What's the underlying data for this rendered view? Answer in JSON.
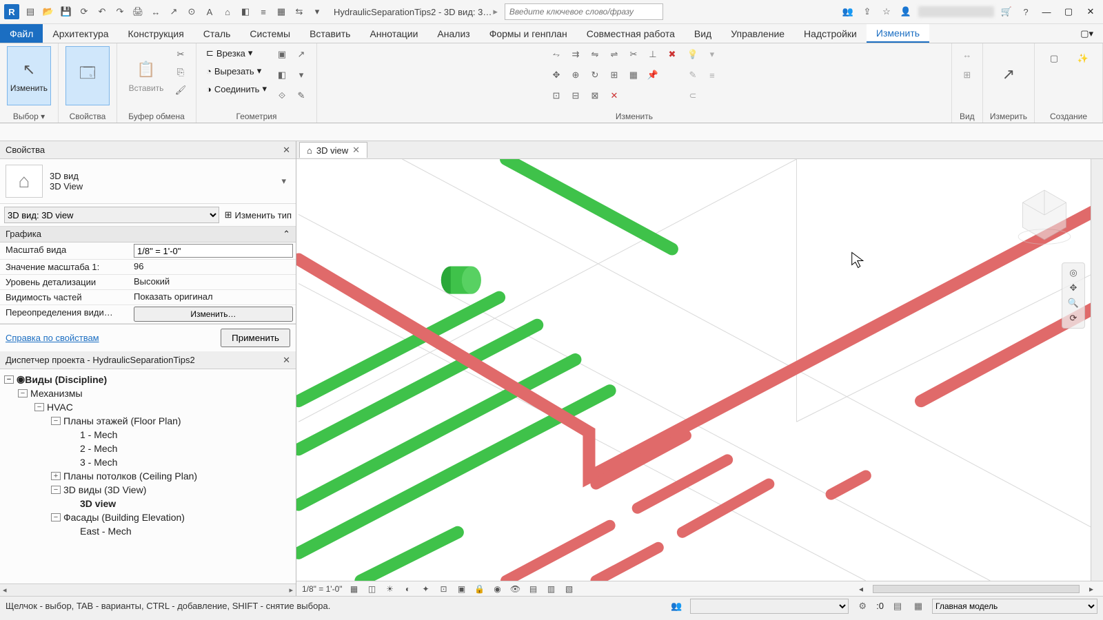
{
  "titlebar": {
    "doc_title": "HydraulicSeparationTips2 - 3D вид: 3…",
    "search_placeholder": "Введите ключевое слово/фразу"
  },
  "ribbon_tabs": [
    "Файл",
    "Архитектура",
    "Конструкция",
    "Сталь",
    "Системы",
    "Вставить",
    "Аннотации",
    "Анализ",
    "Формы и генплан",
    "Совместная работа",
    "Вид",
    "Управление",
    "Надстройки",
    "Изменить"
  ],
  "ribbon_active_index": 13,
  "ribbon": {
    "select": {
      "modify": "Изменить",
      "label": "Выбор"
    },
    "properties": {
      "label": "Свойства"
    },
    "clipboard": {
      "paste": "Вставить",
      "label": "Буфер обмена"
    },
    "geometry": {
      "cope": "Врезка",
      "cut": "Вырезать",
      "join": "Соединить",
      "label": "Геометрия"
    },
    "modify": {
      "label": "Изменить"
    },
    "view": {
      "label": "Вид"
    },
    "measure": {
      "label": "Измерить"
    },
    "create": {
      "label": "Создание"
    }
  },
  "properties": {
    "title": "Свойства",
    "family": "3D вид",
    "type": "3D View",
    "instance_selector": "3D вид: 3D view",
    "edit_type": "Изменить тип",
    "group": "Графика",
    "rows": [
      {
        "k": "Масштаб вида",
        "v": "1/8\" = 1'-0\"",
        "kind": "input"
      },
      {
        "k": "Значение масштаба    1:",
        "v": "96",
        "kind": "text"
      },
      {
        "k": "Уровень детализации",
        "v": "Высокий",
        "kind": "text"
      },
      {
        "k": "Видимость частей",
        "v": "Показать оригинал",
        "kind": "text"
      },
      {
        "k": "Переопределения види…",
        "v": "Изменить…",
        "kind": "button"
      }
    ],
    "help_link": "Справка по свойствам",
    "apply": "Применить"
  },
  "browser": {
    "title": "Диспетчер проекта - HydraulicSeparationTips2",
    "tree": [
      {
        "indent": 0,
        "tw": "−",
        "label": "Виды (Discipline)",
        "bold": true,
        "icon": true
      },
      {
        "indent": 1,
        "tw": "−",
        "label": "Механизмы"
      },
      {
        "indent": 2,
        "tw": "−",
        "label": "HVAC"
      },
      {
        "indent": 3,
        "tw": "−",
        "label": "Планы этажей (Floor Plan)"
      },
      {
        "indent": 4,
        "tw": "",
        "label": "1 - Mech"
      },
      {
        "indent": 4,
        "tw": "",
        "label": "2 - Mech"
      },
      {
        "indent": 4,
        "tw": "",
        "label": "3 - Mech"
      },
      {
        "indent": 3,
        "tw": "+",
        "label": "Планы потолков (Ceiling Plan)"
      },
      {
        "indent": 3,
        "tw": "−",
        "label": "3D виды (3D View)"
      },
      {
        "indent": 4,
        "tw": "",
        "label": "3D view",
        "bold": true
      },
      {
        "indent": 3,
        "tw": "−",
        "label": "Фасады (Building Elevation)"
      },
      {
        "indent": 4,
        "tw": "",
        "label": "East - Mech"
      }
    ]
  },
  "view": {
    "tab_label": "3D view",
    "scale": "1/8\" = 1'-0\""
  },
  "statusbar": {
    "hint": "Щелчок - выбор, TAB - варианты, CTRL - добавление, SHIFT - снятие выбора.",
    "zero": ":0",
    "workset": "Главная модель"
  },
  "colors": {
    "green": "#3fc24a",
    "red": "#e06a6a"
  }
}
